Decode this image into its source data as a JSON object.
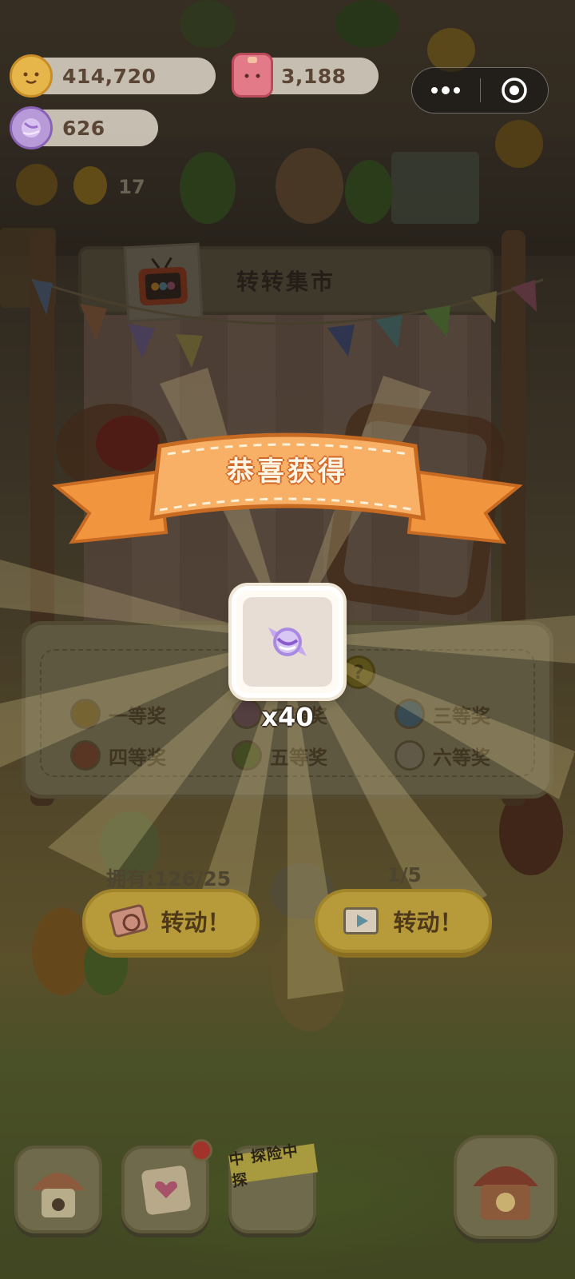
{
  "currencies": {
    "coins": {
      "value": "414,720",
      "icon": "cookie-coin-icon"
    },
    "jelly": {
      "value": "3,188",
      "icon": "jelly-cube-icon"
    },
    "candy": {
      "value": "626",
      "icon": "wrapped-candy-icon"
    }
  },
  "capsule_menu": {
    "more_icon": "more-dots-icon",
    "close_icon": "target-close-icon"
  },
  "scene": {
    "background_counter": "17"
  },
  "stall": {
    "title": "转转集市",
    "tv_icon": "tv-icon"
  },
  "prize_legend": [
    {
      "label": "一等奖",
      "color": "#c89a2a"
    },
    {
      "label": "二等奖",
      "color": "#d69aa8"
    },
    {
      "label": "三等奖",
      "color": "#7fb6c9"
    },
    {
      "label": "四等奖",
      "color": "#d9754f"
    },
    {
      "label": "五等奖",
      "color": "#97b04a"
    },
    {
      "label": "六等奖",
      "color": "#e6dcc3"
    }
  ],
  "legend_question_mark": "?",
  "reward_popup": {
    "title": "恭喜获得",
    "item_icon": "wrapped-candy-icon",
    "quantity": "x40"
  },
  "spin": {
    "owned_count": "拥有:126/25",
    "ad_count": "1/5",
    "ticket_button_label": "转动！",
    "video_button_label": "转动！"
  },
  "bottom_nav": {
    "home_icon": "mushroom-house-icon",
    "diary_icon": "diary-heart-icon",
    "adventure_label": "中 探险中 探",
    "carnival_icon": "carnival-tent-icon"
  },
  "colors": {
    "ribbon": "#f5a85a",
    "ribbon_text_outline": "#d2692a",
    "reward_card": "#fffaf3"
  }
}
